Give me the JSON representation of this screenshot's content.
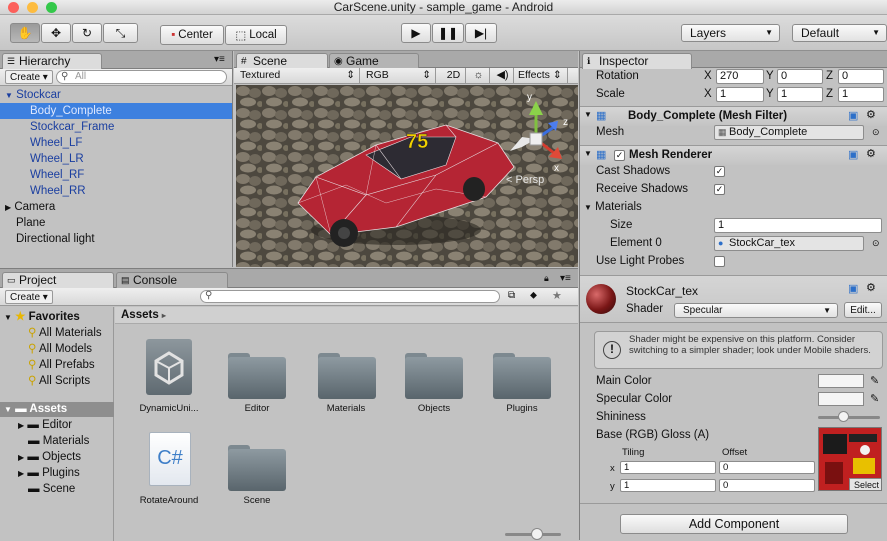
{
  "window": {
    "title": "CarScene.unity - sample_game - Android",
    "colors": {
      "close": "#fc605b",
      "min": "#fdbc40",
      "max": "#34c84a"
    }
  },
  "toolbar": {
    "pivot": "Center",
    "space": "Local",
    "layers": "Layers",
    "layout": "Default"
  },
  "hierarchy": {
    "tab": "Hierarchy",
    "create": "Create",
    "search_placeholder": "All",
    "items": [
      "Stockcar",
      "Body_Complete",
      "Stockcar_Frame",
      "Wheel_LF",
      "Wheel_LR",
      "Wheel_RF",
      "Wheel_RR",
      "Camera",
      "Plane",
      "Directional light"
    ]
  },
  "scene": {
    "tab_scene": "Scene",
    "tab_game": "Game",
    "render_mode": "Textured",
    "color_mode": "RGB",
    "twod": "2D",
    "effects": "Effects",
    "persp": "Persp",
    "car_number": "75"
  },
  "project": {
    "tab_project": "Project",
    "tab_console": "Console",
    "create": "Create",
    "favorites_label": "Favorites",
    "favorites": [
      "All Materials",
      "All Models",
      "All Prefabs",
      "All Scripts"
    ],
    "assets_label": "Assets",
    "asset_folders": [
      "Editor",
      "Materials",
      "Objects",
      "Plugins",
      "Scene"
    ],
    "breadcrumb": "Assets",
    "grid": [
      "DynamicUni...",
      "Editor",
      "Materials",
      "Objects",
      "Plugins",
      "RotateAround",
      "Scene"
    ],
    "cs_label": "C#"
  },
  "inspector": {
    "tab": "Inspector",
    "rotation": {
      "label": "Rotation",
      "x": "270",
      "y": "0",
      "z": "0"
    },
    "scale": {
      "label": "Scale",
      "x": "1",
      "y": "1",
      "z": "1"
    },
    "axis": {
      "x": "X",
      "y": "Y",
      "z": "Z"
    },
    "mesh_filter": {
      "title": "Body_Complete (Mesh Filter)",
      "mesh_label": "Mesh",
      "mesh_value": "Body_Complete"
    },
    "mesh_renderer": {
      "title": "Mesh Renderer",
      "cast_shadows": "Cast Shadows",
      "receive_shadows": "Receive Shadows",
      "materials": "Materials",
      "size_label": "Size",
      "size_value": "1",
      "element0_label": "Element 0",
      "element0_value": "StockCar_tex",
      "light_probes": "Use Light Probes"
    },
    "material": {
      "name": "StockCar_tex",
      "shader_label": "Shader",
      "shader_value": "Specular",
      "edit": "Edit...",
      "warning": "Shader might be expensive on this platform. Consider switching to a simpler shader; look under Mobile shaders.",
      "main_color": "Main Color",
      "specular_color": "Specular Color",
      "shininess": "Shininess",
      "base": "Base (RGB) Gloss (A)",
      "tiling": "Tiling",
      "offset": "Offset",
      "x": "x",
      "y": "y",
      "tx": "1",
      "ty": "1",
      "ox": "0",
      "oy": "0",
      "select": "Select"
    },
    "add_component": "Add Component"
  }
}
